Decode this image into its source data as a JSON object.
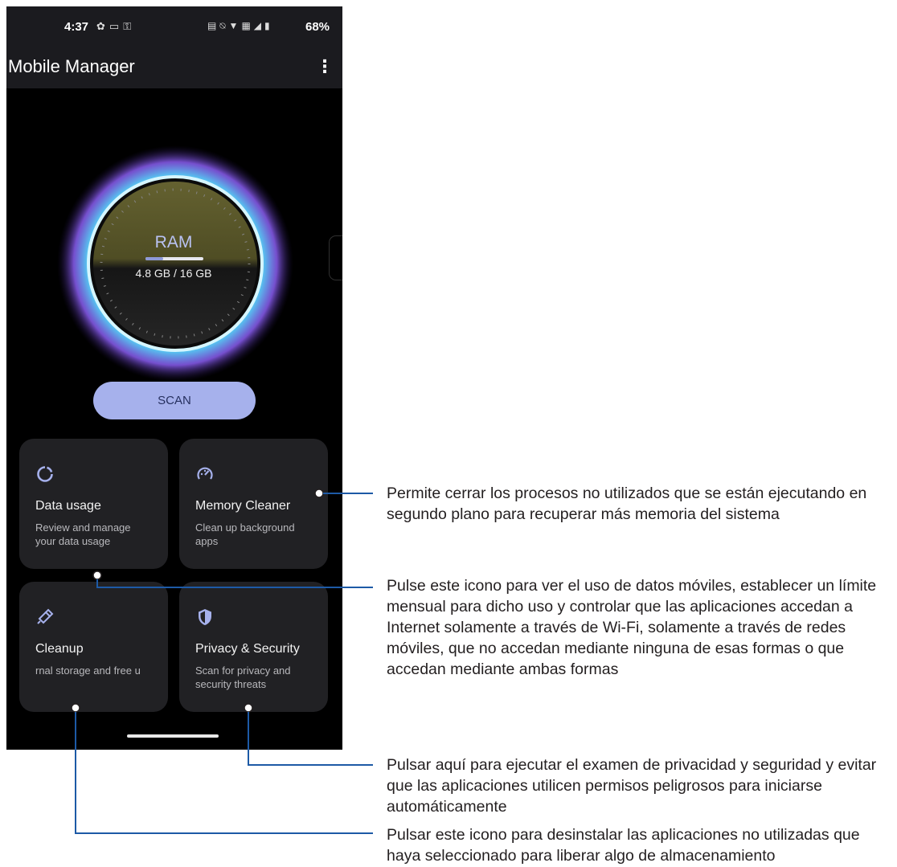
{
  "status_bar": {
    "time": "4:37",
    "left_icons": [
      "gear-icon",
      "image-icon",
      "lock-icon"
    ],
    "right_icons": [
      "nfc-icon",
      "mute-icon",
      "wifi-icon",
      "lte-icon",
      "signal-icon",
      "battery-icon"
    ],
    "battery_text": "68%"
  },
  "app_bar": {
    "title": "Mobile Manager",
    "menu_icon": "more-vert-icon"
  },
  "ram": {
    "label": "RAM",
    "value_text": "4.8 GB / 16 GB",
    "used_fraction": 0.3
  },
  "scan": {
    "label": "SCAN"
  },
  "cards": [
    {
      "title": "Data usage",
      "description": "Review and manage\nyour data usage",
      "icon": "data-usage-icon"
    },
    {
      "title": "Memory Cleaner",
      "description": "Clean up background\napps",
      "icon": "speedometer-icon"
    },
    {
      "title": "Cleanup",
      "description": "rnal storage and free u",
      "icon": "broom-icon"
    },
    {
      "title": "Privacy & Security",
      "description": "Scan for privacy and\nsecurity threats",
      "icon": "shield-icon"
    }
  ],
  "callouts": [
    {
      "text": "Permite cerrar los procesos no utilizados que se están ejecutando en segundo plano para recuperar más memoria del sistema"
    },
    {
      "text": "Pulse este icono para ver el uso de datos móviles, establecer un límite mensual para dicho uso y controlar que las aplicaciones accedan a Internet solamente a través de Wi-Fi, solamente a través de redes móviles, que no accedan mediante ninguna de esas formas o que accedan mediante ambas formas"
    },
    {
      "text": "Pulsar aquí para ejecutar el examen de privacidad y seguridad y evitar que las aplicaciones utilicen permisos peligrosos para iniciarse automáticamente"
    },
    {
      "text": "Pulsar este icono para desinstalar las aplicaciones no utilizadas que haya seleccionado para liberar algo de almacenamiento"
    }
  ],
  "colors": {
    "background": "#000000",
    "card": "#212124",
    "accent": "#a6b1ec",
    "callout_line": "#1d5aa6"
  }
}
